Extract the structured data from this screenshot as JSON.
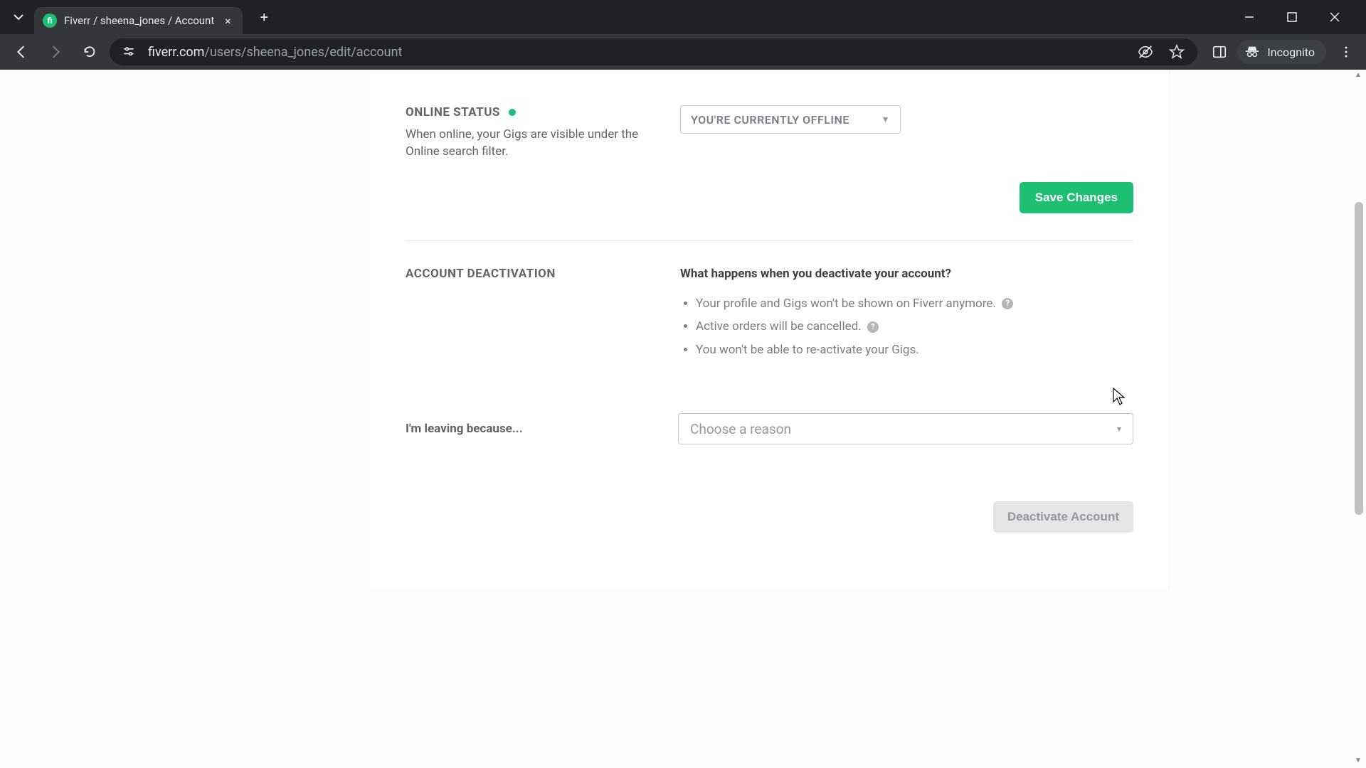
{
  "browser": {
    "tab_title": "Fiverr / sheena_jones / Account",
    "url_domain": "fiverr.com",
    "url_path": "/users/sheena_jones/edit/account",
    "incognito_label": "Incognito"
  },
  "online_status": {
    "heading": "ONLINE STATUS",
    "subtext": "When online, your Gigs are visible under the Online search filter.",
    "selected": "YOU'RE CURRENTLY OFFLINE"
  },
  "buttons": {
    "save": "Save Changes",
    "deactivate": "Deactivate Account"
  },
  "deactivation": {
    "heading": "ACCOUNT DEACTIVATION",
    "info_title": "What happens when you deactivate your account?",
    "items": [
      "Your profile and Gigs won't be shown on Fiverr anymore.",
      "Active orders will be cancelled.",
      "You won't be able to re-activate your Gigs."
    ],
    "leaving_label": "I'm leaving because...",
    "reason_placeholder": "Choose a reason"
  }
}
